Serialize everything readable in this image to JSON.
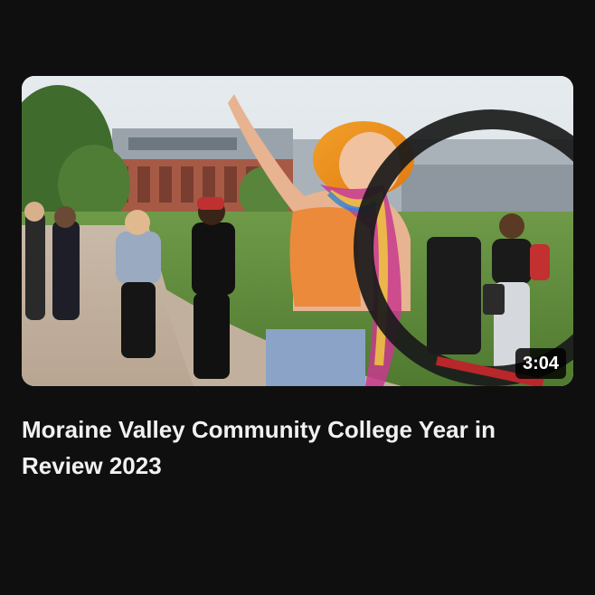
{
  "video": {
    "title": "Moraine Valley Community College Year in Review 2023",
    "duration": "3:04",
    "thumbnail_subject": "campus-event-photo"
  },
  "colors": {
    "background": "#0f0f0f",
    "title_text": "#f1f1f1",
    "duration_badge_bg": "#000000",
    "duration_text": "#ffffff"
  }
}
